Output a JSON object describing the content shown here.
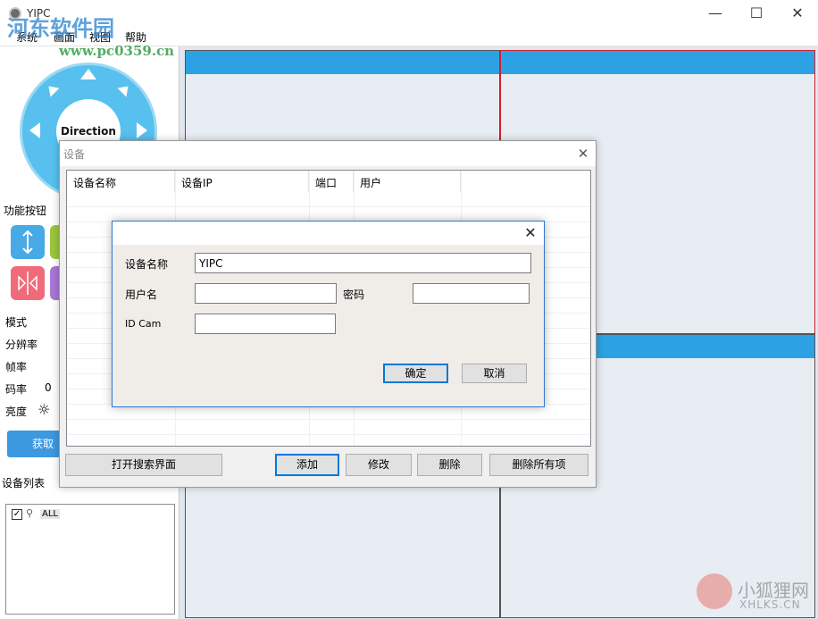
{
  "window": {
    "title": "YIPC",
    "minimize": "—",
    "maximize": "☐",
    "close": "✕"
  },
  "menu": [
    "系统",
    "画面",
    "视图",
    "帮助"
  ],
  "left_panel": {
    "ptz_center_label": "Direction",
    "function_buttons_label": "功能按钮",
    "params": [
      {
        "label": "模式",
        "value": ""
      },
      {
        "label": "分辨率",
        "value": ""
      },
      {
        "label": "帧率",
        "value": ""
      },
      {
        "label": "码率",
        "value": "0"
      },
      {
        "label": "亮度",
        "value": ""
      }
    ],
    "get_button": "获取",
    "device_list_label": "设备列表",
    "tree_root": "ALL"
  },
  "device_dialog": {
    "title": "设备",
    "close": "✕",
    "columns": [
      "设备名称",
      "设备IP",
      "端口",
      "用户"
    ],
    "buttons": {
      "open_search": "打开搜索界面",
      "add": "添加",
      "modify": "修改",
      "delete": "删除",
      "delete_all": "删除所有项"
    }
  },
  "edit_dialog": {
    "close": "✕",
    "device_name_label": "设备名称",
    "device_name_value": "YIPC",
    "username_label": "用户名",
    "username_value": "",
    "password_label": "密码",
    "password_value": "",
    "id_cam_label": "ID Cam",
    "id_cam_value": "",
    "ok": "确定",
    "cancel": "取消"
  },
  "watermarks": {
    "site1": "河东软件园",
    "site1_url": "www.pc0359.cn",
    "site2": "小狐狸网",
    "site2_url": "XHLKS.CN"
  },
  "colors": {
    "accent_blue": "#2ca2e4",
    "button_blue": "#3c98df",
    "selected_cell_border": "#d0202a"
  }
}
